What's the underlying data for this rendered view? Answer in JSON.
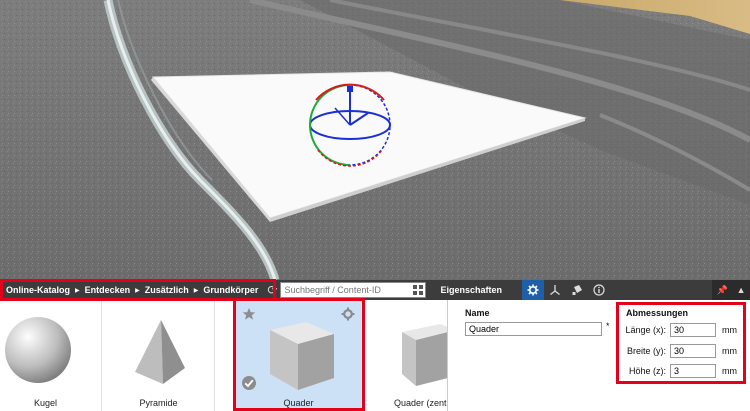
{
  "breadcrumb": [
    "Online-Katalog",
    "Entdecken",
    "Zusätzlich",
    "Grundkörper"
  ],
  "search": {
    "placeholder": "Suchbegriff / Content-ID"
  },
  "properties": {
    "title": "Eigenschaften"
  },
  "catalog": {
    "items": [
      {
        "label": "Kugel"
      },
      {
        "label": "Pyramide"
      },
      {
        "label": "Quader",
        "selected": true
      },
      {
        "label": "Quader (zentr"
      }
    ]
  },
  "panel": {
    "name_label": "Name",
    "name_value": "Quader",
    "required_mark": "*",
    "dims_title": "Abmessungen",
    "dims": [
      {
        "label": "Länge (x):",
        "value": "30",
        "unit": "mm"
      },
      {
        "label": "Breite (y):",
        "value": "30",
        "unit": "mm"
      },
      {
        "label": "Höhe (z):",
        "value": "3",
        "unit": "mm"
      }
    ]
  },
  "icons": [
    "refresh-icon",
    "grid-view-icon",
    "gear-icon",
    "axes-icon",
    "paint-icon",
    "info-icon",
    "pin-icon",
    "expand-icon",
    "favorite-star-icon",
    "settings-gear-icon",
    "checkmark-icon"
  ],
  "colors": {
    "highlight": "#e3001b",
    "active_tab": "#1e5fa8",
    "selected_tile": "#cce0f6"
  }
}
